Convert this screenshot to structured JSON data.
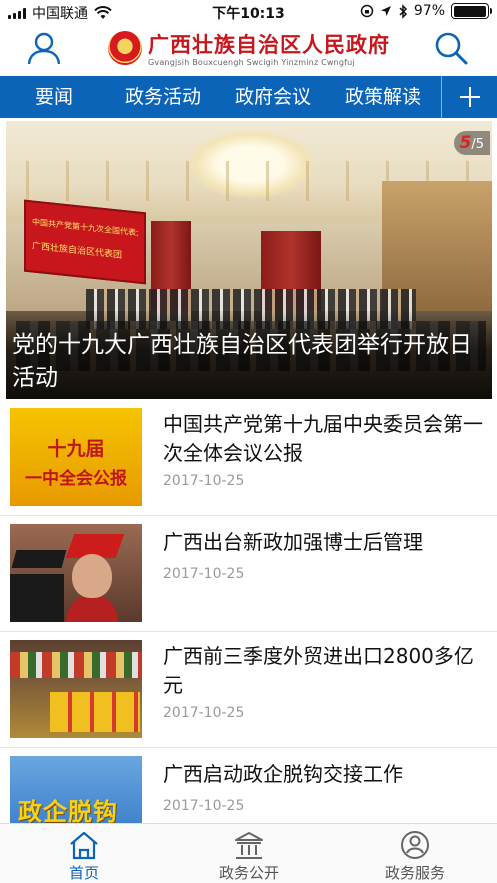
{
  "status_bar": {
    "carrier": "中国联通",
    "time": "下午10:13",
    "battery": "97%",
    "battery_level": 0.97
  },
  "header": {
    "title": "广西壮族自治区人民政府",
    "subtitle": "Gvangjsih Bouxcuengh Swcigih Yinzminz Cwngfuj",
    "left_icon": "user-icon",
    "right_icon": "search-icon"
  },
  "tabs": [
    {
      "label": "要闻",
      "active": true
    },
    {
      "label": "政务活动",
      "active": false
    },
    {
      "label": "政府会议",
      "active": false
    },
    {
      "label": "政策解读",
      "active": false
    }
  ],
  "hero": {
    "current": "5",
    "total": "/5",
    "title": "党的十九大广西壮族自治区代表团举行开放日活动",
    "banner_line1": "中国共产党第十九次全国代表大会",
    "banner_line2": "广西壮族自治区代表团"
  },
  "news": [
    {
      "title": "中国共产党第十九届中央委员会第一次全体会议公报",
      "date": "2017-10-25",
      "thumb_text1": "十九届",
      "thumb_text2": "一中全会公报"
    },
    {
      "title": "广西出台新政加强博士后管理",
      "date": "2017-10-25"
    },
    {
      "title": "广西前三季度外贸进出口2800多亿元",
      "date": "2017-10-25"
    },
    {
      "title": "广西启动政企脱钩交接工作",
      "date": "2017-10-25",
      "thumb_text": "政企脱钩"
    }
  ],
  "bottom_tabs": [
    {
      "label": "首页",
      "icon": "home-icon",
      "active": true
    },
    {
      "label": "政务公开",
      "icon": "building-icon",
      "active": false
    },
    {
      "label": "政务服务",
      "icon": "service-icon",
      "active": false
    }
  ],
  "colors": {
    "primary_blue": "#0c64b8",
    "brand_red": "#c8161d",
    "date_gray": "#9a9a9a"
  }
}
